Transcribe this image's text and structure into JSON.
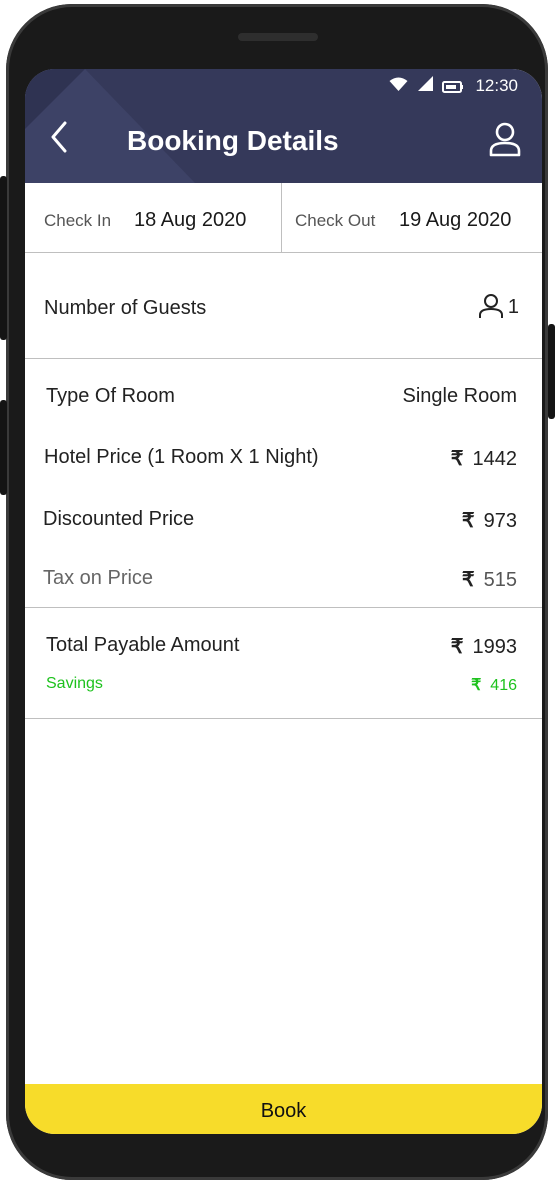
{
  "status_bar": {
    "time": "12:30",
    "icons": [
      "wifi-icon",
      "signal-icon",
      "battery-icon"
    ]
  },
  "header": {
    "title": "Booking Details",
    "back_icon": "chevron-left-icon",
    "profile_icon": "person-icon"
  },
  "dates": {
    "check_in_label": "Check In",
    "check_in_value": "18 Aug 2020",
    "check_out_label": "Check Out",
    "check_out_value": "19 Aug 2020"
  },
  "guests": {
    "label": "Number of Guests",
    "count": "1",
    "icon": "person-icon"
  },
  "pricing": {
    "currency": "₹",
    "rows": [
      {
        "label": "Type Of Room",
        "value": "Single Room"
      },
      {
        "label": "Hotel Price (1 Room X 1 Night)",
        "value": "1442"
      },
      {
        "label": "Discounted Price",
        "value": "973"
      },
      {
        "label": "Tax on Price",
        "value": "515"
      }
    ]
  },
  "total": {
    "label": "Total Payable Amount",
    "value": "1993",
    "savings_label": "Savings",
    "savings_value": "416"
  },
  "book_button": {
    "label": "Book"
  },
  "colors": {
    "header_bg": "#35395a",
    "accent_yellow": "#f7dc2a",
    "savings_green": "#1ec21e"
  }
}
